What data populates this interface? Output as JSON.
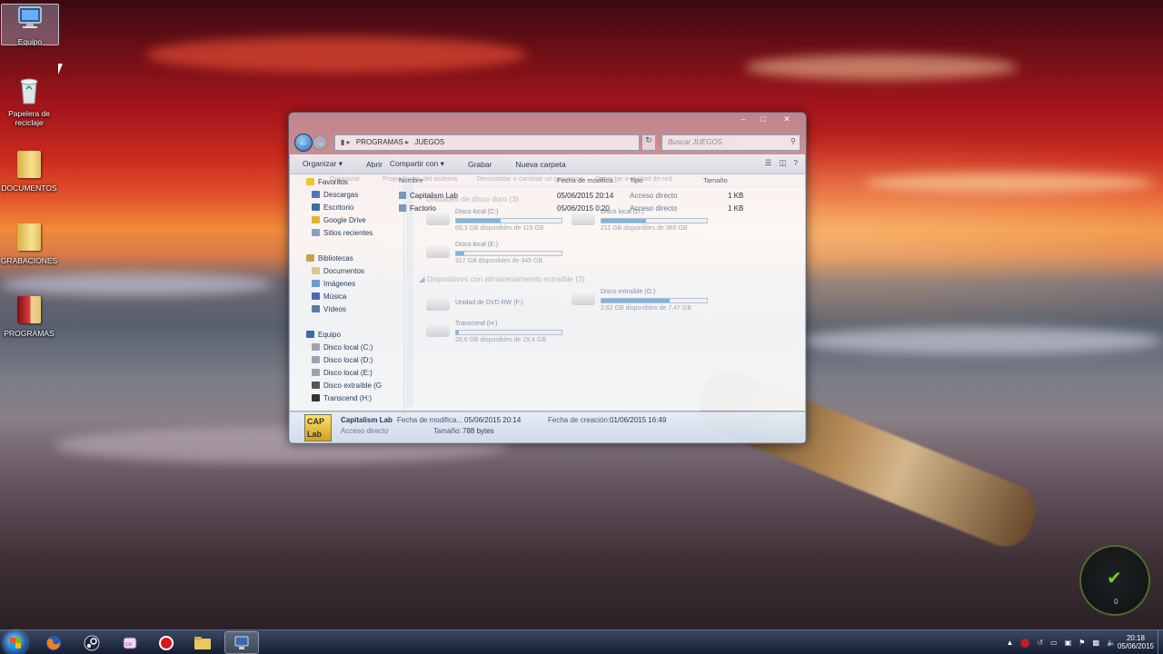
{
  "desktop": {
    "icons": [
      {
        "label": "Equipo",
        "icon": "computer-icon"
      },
      {
        "label": "Papelera de reciclaje",
        "icon": "recycle-bin-icon"
      },
      {
        "label": "DOCUMENTOS",
        "icon": "folder-icon"
      },
      {
        "label": "GRABACIONES",
        "icon": "folder-icon"
      },
      {
        "label": "PROGRAMAS",
        "icon": "folder-icon"
      }
    ]
  },
  "explorer": {
    "address": [
      "PROGRAMAS",
      "JUEGOS"
    ],
    "search_placeholder": "Buscar JUEGOS",
    "toolbar": [
      "Organizar",
      "Abrir",
      "Compartir con",
      "Grabar",
      "Nueva carpeta"
    ],
    "columns": [
      "Nombre",
      "Fecha de modifica...",
      "Tipo",
      "Tamaño"
    ],
    "files": [
      {
        "name": "Capitalism Lab",
        "date": "05/06/2015 20:14",
        "type": "Acceso directo",
        "size": "1 KB"
      },
      {
        "name": "Factorio",
        "date": "05/06/2015 0:20",
        "type": "Acceso directo",
        "size": "1 KB"
      }
    ],
    "nav": {
      "favorites": "Favoritos",
      "favorites_items": [
        "Descargas",
        "Escritorio",
        "Google Drive",
        "Sitios recientes"
      ],
      "libraries": "Bibliotecas",
      "libraries_items": [
        "Documentos",
        "Imágenes",
        "Música",
        "Vídeos"
      ],
      "computer": "Equipo",
      "computer_items": [
        "Disco local (C:)",
        "Disco local (D:)",
        "Disco local (E:)",
        "Disco extraíble (G",
        "Transcend (H:)"
      ]
    },
    "ghost_window": {
      "toolbar": [
        "Organizar",
        "Propiedades del sistema",
        "Desinstalar o cambiar un programa",
        "Conectar a unidad de red"
      ],
      "section_hdd": "Unidades de disco duro (3)",
      "section_removable": "Dispositivos con almacenamiento extraíble (3)",
      "drives": [
        {
          "name": "Disco local (C:)",
          "free": "69,3 GB disponibles de 119 GB",
          "used": 0.42
        },
        {
          "name": "Disco local (D:)",
          "free": "211 GB disponibles de 365 GB",
          "used": 0.42
        },
        {
          "name": "Disco local (E:)",
          "free": "317 GB disponibles de 345 GB",
          "used": 0.08
        },
        {
          "name": "Unidad de DVD RW (F:)",
          "free": "",
          "used": null
        },
        {
          "name": "Disco extraíble (G:)",
          "free": "2,62 GB disponibles de 7,47 GB",
          "used": 0.65
        },
        {
          "name": "Transcend (H:)",
          "free": "28,6 GB disponibles de 29,4 GB",
          "used": 0.03
        }
      ]
    },
    "details": {
      "name": "Capitalism Lab",
      "type": "Acceso directo",
      "modified_label": "Fecha de modifica...",
      "modified": "05/06/2015 20:14",
      "created_label": "Fecha de creación:",
      "created": "01/06/2015 16:49",
      "size_label": "Tamaño:",
      "size": "788 bytes",
      "thumb": "CAP Lab"
    }
  },
  "taskbar": {
    "time": "20:18",
    "date": "05/06/2015"
  },
  "gadget": {
    "value": "0"
  }
}
